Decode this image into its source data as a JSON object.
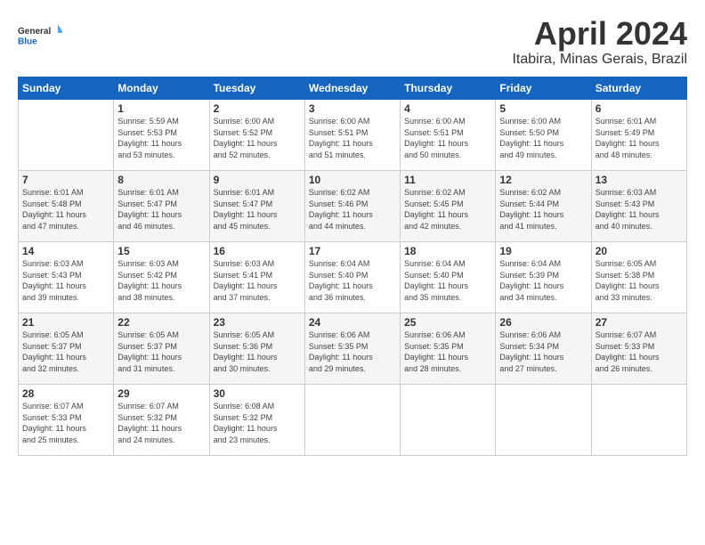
{
  "logo": {
    "line1": "General",
    "line2": "Blue"
  },
  "title": "April 2024",
  "location": "Itabira, Minas Gerais, Brazil",
  "weekdays": [
    "Sunday",
    "Monday",
    "Tuesday",
    "Wednesday",
    "Thursday",
    "Friday",
    "Saturday"
  ],
  "weeks": [
    [
      {
        "day": "",
        "info": ""
      },
      {
        "day": "1",
        "info": "Sunrise: 5:59 AM\nSunset: 5:53 PM\nDaylight: 11 hours\nand 53 minutes."
      },
      {
        "day": "2",
        "info": "Sunrise: 6:00 AM\nSunset: 5:52 PM\nDaylight: 11 hours\nand 52 minutes."
      },
      {
        "day": "3",
        "info": "Sunrise: 6:00 AM\nSunset: 5:51 PM\nDaylight: 11 hours\nand 51 minutes."
      },
      {
        "day": "4",
        "info": "Sunrise: 6:00 AM\nSunset: 5:51 PM\nDaylight: 11 hours\nand 50 minutes."
      },
      {
        "day": "5",
        "info": "Sunrise: 6:00 AM\nSunset: 5:50 PM\nDaylight: 11 hours\nand 49 minutes."
      },
      {
        "day": "6",
        "info": "Sunrise: 6:01 AM\nSunset: 5:49 PM\nDaylight: 11 hours\nand 48 minutes."
      }
    ],
    [
      {
        "day": "7",
        "info": "Sunrise: 6:01 AM\nSunset: 5:48 PM\nDaylight: 11 hours\nand 47 minutes."
      },
      {
        "day": "8",
        "info": "Sunrise: 6:01 AM\nSunset: 5:47 PM\nDaylight: 11 hours\nand 46 minutes."
      },
      {
        "day": "9",
        "info": "Sunrise: 6:01 AM\nSunset: 5:47 PM\nDaylight: 11 hours\nand 45 minutes."
      },
      {
        "day": "10",
        "info": "Sunrise: 6:02 AM\nSunset: 5:46 PM\nDaylight: 11 hours\nand 44 minutes."
      },
      {
        "day": "11",
        "info": "Sunrise: 6:02 AM\nSunset: 5:45 PM\nDaylight: 11 hours\nand 42 minutes."
      },
      {
        "day": "12",
        "info": "Sunrise: 6:02 AM\nSunset: 5:44 PM\nDaylight: 11 hours\nand 41 minutes."
      },
      {
        "day": "13",
        "info": "Sunrise: 6:03 AM\nSunset: 5:43 PM\nDaylight: 11 hours\nand 40 minutes."
      }
    ],
    [
      {
        "day": "14",
        "info": "Sunrise: 6:03 AM\nSunset: 5:43 PM\nDaylight: 11 hours\nand 39 minutes."
      },
      {
        "day": "15",
        "info": "Sunrise: 6:03 AM\nSunset: 5:42 PM\nDaylight: 11 hours\nand 38 minutes."
      },
      {
        "day": "16",
        "info": "Sunrise: 6:03 AM\nSunset: 5:41 PM\nDaylight: 11 hours\nand 37 minutes."
      },
      {
        "day": "17",
        "info": "Sunrise: 6:04 AM\nSunset: 5:40 PM\nDaylight: 11 hours\nand 36 minutes."
      },
      {
        "day": "18",
        "info": "Sunrise: 6:04 AM\nSunset: 5:40 PM\nDaylight: 11 hours\nand 35 minutes."
      },
      {
        "day": "19",
        "info": "Sunrise: 6:04 AM\nSunset: 5:39 PM\nDaylight: 11 hours\nand 34 minutes."
      },
      {
        "day": "20",
        "info": "Sunrise: 6:05 AM\nSunset: 5:38 PM\nDaylight: 11 hours\nand 33 minutes."
      }
    ],
    [
      {
        "day": "21",
        "info": "Sunrise: 6:05 AM\nSunset: 5:37 PM\nDaylight: 11 hours\nand 32 minutes."
      },
      {
        "day": "22",
        "info": "Sunrise: 6:05 AM\nSunset: 5:37 PM\nDaylight: 11 hours\nand 31 minutes."
      },
      {
        "day": "23",
        "info": "Sunrise: 6:05 AM\nSunset: 5:36 PM\nDaylight: 11 hours\nand 30 minutes."
      },
      {
        "day": "24",
        "info": "Sunrise: 6:06 AM\nSunset: 5:35 PM\nDaylight: 11 hours\nand 29 minutes."
      },
      {
        "day": "25",
        "info": "Sunrise: 6:06 AM\nSunset: 5:35 PM\nDaylight: 11 hours\nand 28 minutes."
      },
      {
        "day": "26",
        "info": "Sunrise: 6:06 AM\nSunset: 5:34 PM\nDaylight: 11 hours\nand 27 minutes."
      },
      {
        "day": "27",
        "info": "Sunrise: 6:07 AM\nSunset: 5:33 PM\nDaylight: 11 hours\nand 26 minutes."
      }
    ],
    [
      {
        "day": "28",
        "info": "Sunrise: 6:07 AM\nSunset: 5:33 PM\nDaylight: 11 hours\nand 25 minutes."
      },
      {
        "day": "29",
        "info": "Sunrise: 6:07 AM\nSunset: 5:32 PM\nDaylight: 11 hours\nand 24 minutes."
      },
      {
        "day": "30",
        "info": "Sunrise: 6:08 AM\nSunset: 5:32 PM\nDaylight: 11 hours\nand 23 minutes."
      },
      {
        "day": "",
        "info": ""
      },
      {
        "day": "",
        "info": ""
      },
      {
        "day": "",
        "info": ""
      },
      {
        "day": "",
        "info": ""
      }
    ]
  ]
}
